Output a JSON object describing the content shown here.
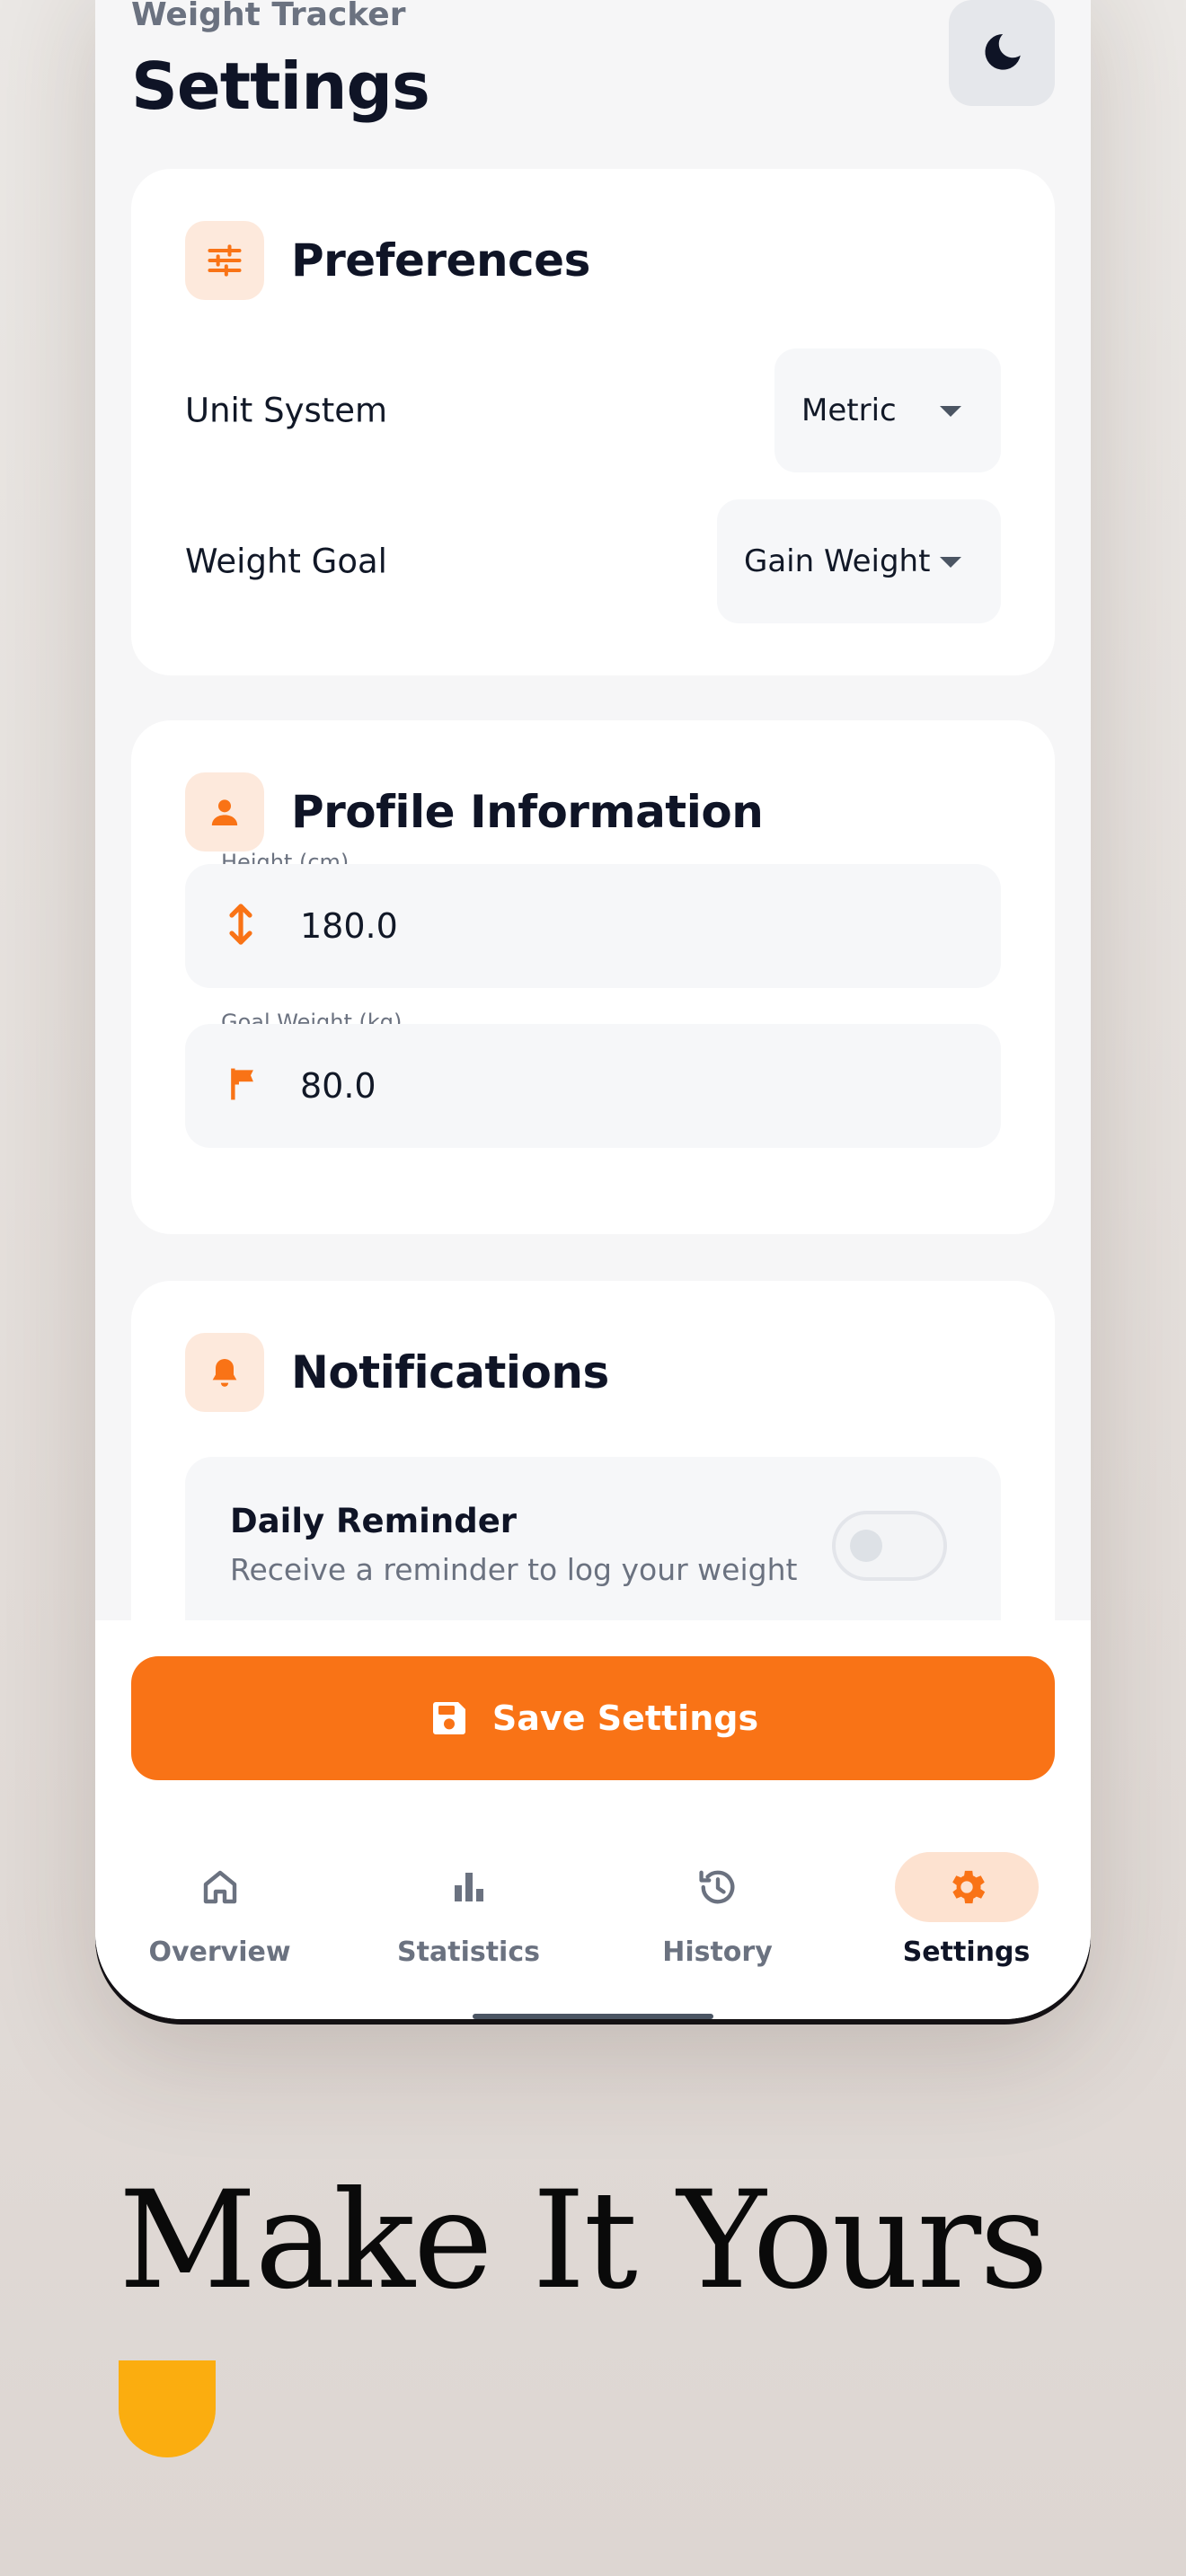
{
  "header": {
    "subtitle": "Weight Tracker",
    "title": "Settings",
    "theme_icon": "moon-icon"
  },
  "preferences": {
    "title": "Preferences",
    "icon": "sliders-icon",
    "unit_system": {
      "label": "Unit System",
      "value": "Metric"
    },
    "weight_goal": {
      "label": "Weight Goal",
      "value": "Gain Weight"
    }
  },
  "profile": {
    "title": "Profile Information",
    "icon": "person-icon",
    "height": {
      "label": "Height (cm)",
      "value": "180.0",
      "icon": "vertical-arrows-icon"
    },
    "goal_weight": {
      "label": "Goal Weight (kg)",
      "value": "80.0",
      "icon": "flag-icon"
    }
  },
  "notifications": {
    "title": "Notifications",
    "icon": "bell-icon",
    "daily_reminder": {
      "title": "Daily Reminder",
      "description": "Receive a reminder to log your weight",
      "enabled": false
    }
  },
  "save_button": {
    "label": "Save Settings",
    "icon": "save-icon"
  },
  "bottom_nav": [
    {
      "label": "Overview",
      "icon": "home-icon",
      "active": false
    },
    {
      "label": "Statistics",
      "icon": "bar-chart-icon",
      "active": false
    },
    {
      "label": "History",
      "icon": "history-icon",
      "active": false
    },
    {
      "label": "Settings",
      "icon": "gear-icon",
      "active": true
    }
  ],
  "tagline": "Make It Yours",
  "colors": {
    "accent": "#f97316",
    "accent_soft": "#fde9dc",
    "tagline_shape": "#fbad0f"
  }
}
